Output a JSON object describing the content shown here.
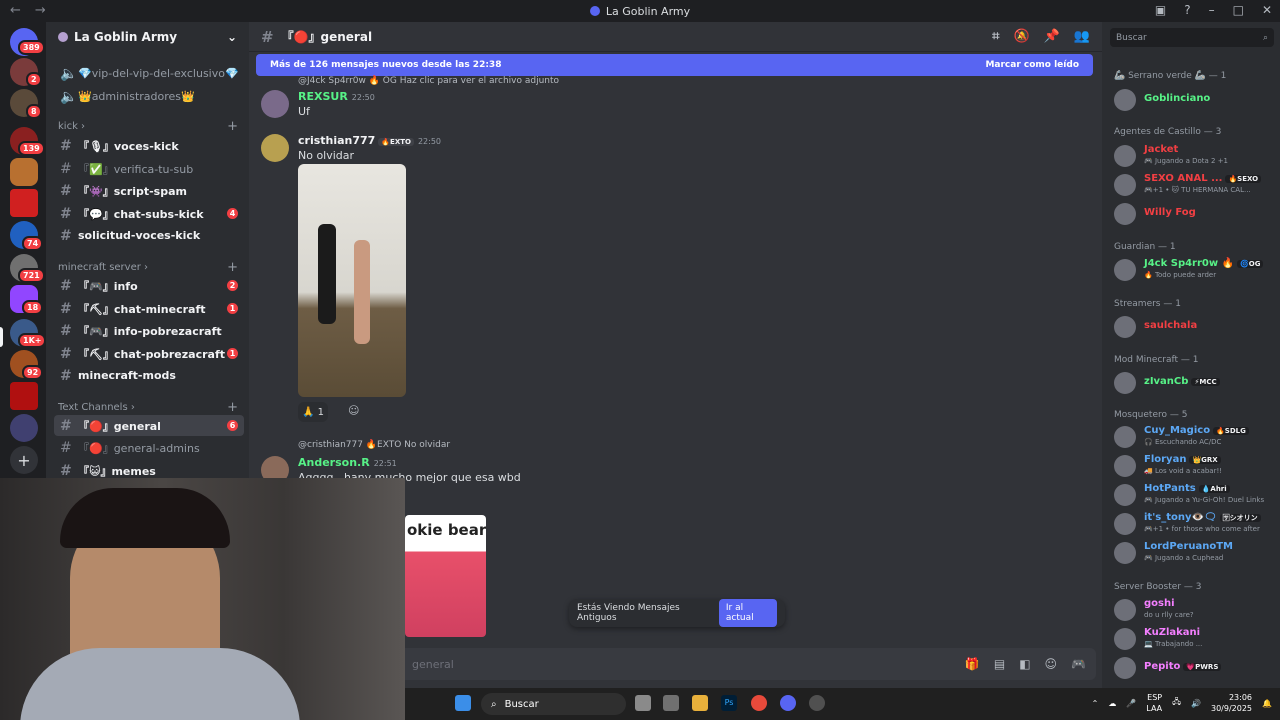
{
  "window": {
    "title": "La Goblin Army"
  },
  "server": {
    "name": "La Goblin Army"
  },
  "guild_badges": [
    "389",
    "2",
    "8",
    "139",
    "74",
    "721",
    "18",
    "1K+",
    "92"
  ],
  "channels": {
    "top": [
      {
        "label": "💎vip-del-vip-del-exclusivo💎"
      },
      {
        "label": "👑administradores👑"
      }
    ],
    "cat_kick": "kick",
    "kick": [
      {
        "label": "『🎙』voces-kick",
        "badge": ""
      },
      {
        "label": "『✅』verifica-tu-sub",
        "badge": ""
      },
      {
        "label": "『👾』script-spam",
        "badge": ""
      },
      {
        "label": "『💬』chat-subs-kick",
        "badge": "4"
      },
      {
        "label": "solicitud-voces-kick",
        "badge": ""
      }
    ],
    "cat_mc": "minecraft server",
    "mc": [
      {
        "label": "『🎮』info",
        "badge": "2"
      },
      {
        "label": "『⛏』chat-minecraft",
        "badge": "1"
      },
      {
        "label": "『🎮』info-pobrezacraft",
        "badge": ""
      },
      {
        "label": "『⛏』chat-pobrezacraft",
        "badge": "1"
      },
      {
        "label": "minecraft-mods",
        "badge": ""
      }
    ],
    "cat_text": "Text Channels",
    "text": [
      {
        "label": "『🔴』general",
        "badge": "6"
      },
      {
        "label": "『🔴』general-admins",
        "badge": ""
      },
      {
        "label": "『😺』memes",
        "badge": ""
      }
    ]
  },
  "header": {
    "channel": "『🔴』general"
  },
  "banner": {
    "text": "Más de 126 mensajes nuevos desde las 22:38",
    "action": "Marcar como leído"
  },
  "messages": [
    {
      "reply": "@J4ck Sp4rr0w 🔥 OG  Haz clic para ver el archivo adjunto",
      "user": "REXSUR",
      "time": "22:50",
      "text": "Uf"
    },
    {
      "user": "cristhian777",
      "tag": "🔥EXTO",
      "time": "22:50",
      "text": "No olvidar",
      "reaction": "🙏 1"
    },
    {
      "reply": "@cristhian777 🔥EXTO No olvidar",
      "user": "Anderson.R",
      "time": "22:51",
      "text": "Agggg...hanv mucho mejor que esa wbd",
      "image_text": "okie bear"
    }
  ],
  "old_pill": {
    "text": "Estás Viendo Mensajes Antiguos",
    "action": "Ir al actual"
  },
  "composer": {
    "placeholder": "general"
  },
  "members_search": "Buscar",
  "roles": [
    {
      "title": "🦾 Serrano verde 🦾 — 1",
      "members": [
        {
          "name": "Goblinciano",
          "color": "#57f287",
          "status": "",
          "tag": ""
        }
      ]
    },
    {
      "title": "Agentes de Castillo — 3",
      "members": [
        {
          "name": "Jacket",
          "color": "#f23f43",
          "status": "🎮 Jugando a Dota 2 +1",
          "tag": ""
        },
        {
          "name": "SEXO ANAL ...",
          "color": "#f23f43",
          "status": "🎮+1 • 🐱 TU HERMANA CAL...",
          "tag": "🔥SEXO"
        },
        {
          "name": "Willy Fog",
          "color": "#f23f43",
          "status": "",
          "tag": ""
        }
      ]
    },
    {
      "title": "Guardian — 1",
      "members": [
        {
          "name": "J4ck Sp4rr0w 🔥",
          "color": "#57f287",
          "status": "🔥 Todo puede arder",
          "tag": "🌀OG"
        }
      ]
    },
    {
      "title": "Streamers — 1",
      "members": [
        {
          "name": "saulchala",
          "color": "#f23f43",
          "status": "",
          "tag": ""
        }
      ]
    },
    {
      "title": "Mod Minecraft — 1",
      "members": [
        {
          "name": "zIvanCb",
          "color": "#57f287",
          "status": "",
          "tag": "⚡MCC"
        }
      ]
    },
    {
      "title": "Mosquetero — 5",
      "members": [
        {
          "name": "Cuy_Magico",
          "color": "#5ca8f5",
          "status": "🎧 Escuchando AC/DC",
          "tag": "🔥SDLG"
        },
        {
          "name": "Floryan",
          "color": "#5ca8f5",
          "status": "🚚 Los void a acabar!!",
          "tag": "👑GRX"
        },
        {
          "name": "HotPants",
          "color": "#5ca8f5",
          "status": "🎮 Jugando a Yu-Gi-Oh! Duel Links",
          "tag": "💧Ahri"
        },
        {
          "name": "it's_tony👁️🗨",
          "color": "#5ca8f5",
          "status": "🎮+1 • for those who come after",
          "tag": "🈂シオリン"
        },
        {
          "name": "LordPeruanoTM",
          "color": "#5ca8f5",
          "status": "🎮 Jugando a Cuphead",
          "tag": ""
        }
      ]
    },
    {
      "title": "Server Booster — 3",
      "members": [
        {
          "name": "goshi",
          "color": "#f47fff",
          "status": "do u rlly care?",
          "tag": ""
        },
        {
          "name": "KuZlakani",
          "color": "#f47fff",
          "status": "💻 Trabajando ...",
          "tag": ""
        },
        {
          "name": "Pepito",
          "color": "#f47fff",
          "status": "",
          "tag": "💗PWRS"
        }
      ]
    }
  ],
  "taskbar": {
    "search": "Buscar",
    "lang": "ESP",
    "layout": "LAA",
    "time": "23:06",
    "date": "30/9/2025"
  }
}
